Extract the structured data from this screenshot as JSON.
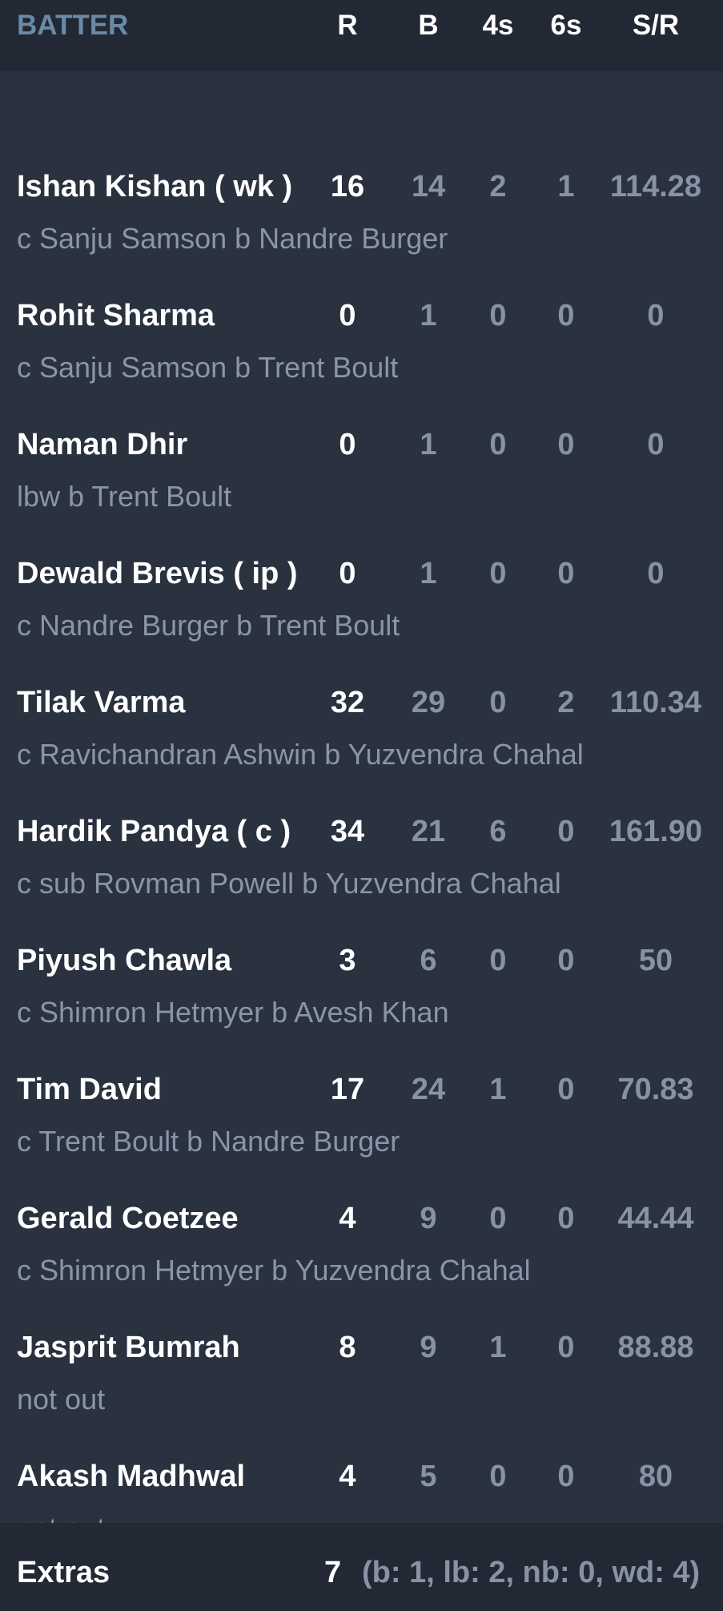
{
  "header": {
    "batter": "BATTER",
    "runs": "R",
    "balls": "B",
    "fours": "4s",
    "sixes": "6s",
    "strike_rate": "S/R"
  },
  "batters": [
    {
      "name": "Ishan Kishan ( wk )",
      "runs": "16",
      "balls": "14",
      "fours": "2",
      "sixes": "1",
      "sr": "114.28",
      "dismissal": "c Sanju Samson b Nandre Burger"
    },
    {
      "name": "Rohit Sharma",
      "runs": "0",
      "balls": "1",
      "fours": "0",
      "sixes": "0",
      "sr": "0",
      "dismissal": "c Sanju Samson b Trent Boult"
    },
    {
      "name": "Naman Dhir",
      "runs": "0",
      "balls": "1",
      "fours": "0",
      "sixes": "0",
      "sr": "0",
      "dismissal": "lbw b Trent Boult"
    },
    {
      "name": "Dewald Brevis ( ip )",
      "runs": "0",
      "balls": "1",
      "fours": "0",
      "sixes": "0",
      "sr": "0",
      "dismissal": "c Nandre Burger b Trent Boult"
    },
    {
      "name": "Tilak Varma",
      "runs": "32",
      "balls": "29",
      "fours": "0",
      "sixes": "2",
      "sr": "110.34",
      "dismissal": "c Ravichandran Ashwin b Yuzvendra Chahal"
    },
    {
      "name": "Hardik Pandya ( c )",
      "runs": "34",
      "balls": "21",
      "fours": "6",
      "sixes": "0",
      "sr": "161.90",
      "dismissal": "c sub Rovman Powell b Yuzvendra Chahal"
    },
    {
      "name": "Piyush Chawla",
      "runs": "3",
      "balls": "6",
      "fours": "0",
      "sixes": "0",
      "sr": "50",
      "dismissal": "c Shimron Hetmyer b Avesh Khan"
    },
    {
      "name": "Tim David",
      "runs": "17",
      "balls": "24",
      "fours": "1",
      "sixes": "0",
      "sr": "70.83",
      "dismissal": "c Trent Boult b Nandre Burger"
    },
    {
      "name": "Gerald Coetzee",
      "runs": "4",
      "balls": "9",
      "fours": "0",
      "sixes": "0",
      "sr": "44.44",
      "dismissal": "c Shimron Hetmyer b Yuzvendra Chahal"
    },
    {
      "name": "Jasprit Bumrah",
      "runs": "8",
      "balls": "9",
      "fours": "1",
      "sixes": "0",
      "sr": "88.88",
      "dismissal": "not out"
    },
    {
      "name": "Akash Madhwal",
      "runs": "4",
      "balls": "5",
      "fours": "0",
      "sixes": "0",
      "sr": "80",
      "dismissal": "not out"
    }
  ],
  "extras": {
    "label": "Extras",
    "total": "7",
    "detail": "(b: 1, lb: 2, nb: 0, wd: 4)"
  },
  "colors": {
    "background": "#2a313f",
    "header_background": "#222834",
    "batter_header": "#6b8aa6",
    "primary_text": "#ffffff",
    "secondary_text": "#8792a4"
  }
}
